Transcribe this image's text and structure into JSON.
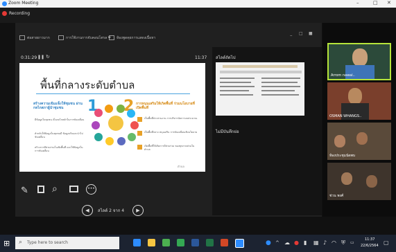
{
  "window": {
    "title": "Zoom Meeting",
    "controls": [
      "–",
      "□",
      "✕"
    ]
  },
  "recording": {
    "label": "Recording"
  },
  "share_toolbar": {
    "items": [
      "ต่อสายยาวมาก",
      "การใช้งานการจับคอนโทรล ▼",
      "ห้องพูดคุยการแสดงเนื้อหา"
    ]
  },
  "presenter": {
    "elapsed": "0:31:29",
    "clock": "11:37"
  },
  "notes": {
    "next_slide_label": "สไลด์ถัดไป",
    "notes_label": "ไม่มีบันทึกย่อ"
  },
  "slide": {
    "title": "พื้นที่กลางระดับตำบล",
    "left_number": "1",
    "right_number": "2",
    "left_heading": "สร้างความเข้มแข็งให้ชุมชน ผ่านกลไกสภาผู้นำชุมชน",
    "right_heading": "การหนุนเสริมให้เกิดพื้นที่ ร่วมนโยบายที่เปิดพื้นที่",
    "left_points": [
      "มีข้อมูลในชุมชน เป็นกลไกหลักในการขับเคลื่อน",
      "สำหรับให้ข้อมูลในชุมชนมี ข้อมูลจริงและนำไปขับเคลื่อน",
      "สร้างการมีส่วนร่วมในเชิงพื้นที่ และใช้ข้อมูลในการขับเคลื่อน"
    ],
    "right_points": [
      "เป็นพื้นที่ประสานงาน การบริหารจัดการงบประมาณ",
      "เป็นพื้นที่กลาง หนุนเสริม การขับเคลื่อนเชิงนโยบาย",
      "เปิดพื้นที่ให้เกิดการมีส่วนร่วม ของทุกภาคส่วนในตำบล"
    ],
    "footer": "ตำบล"
  },
  "slide_nav": {
    "prev": "◀",
    "next": "▶",
    "page_label": "สไลด์ 2 จาก 4"
  },
  "tool_icons": [
    "pen-icon",
    "eraser-icon",
    "zoom-icon",
    "screen-icon",
    "more-icon"
  ],
  "participants": [
    {
      "name": "Arrom nawai..",
      "active": true
    },
    {
      "name": "OSMAN WHANGS.."
    },
    {
      "name": "ห้องประชุมนัดพบ"
    },
    {
      "name": "ช่วน พงศ์"
    }
  ],
  "taskbar": {
    "search_placeholder": "Type here to search",
    "time": "11:37",
    "date": "22/6/2564"
  },
  "colors": {
    "accent_blue": "#2d8cff",
    "record_red": "#e53935",
    "active_border": "#b6e53a",
    "taskbar_bg": "#1c2331"
  }
}
